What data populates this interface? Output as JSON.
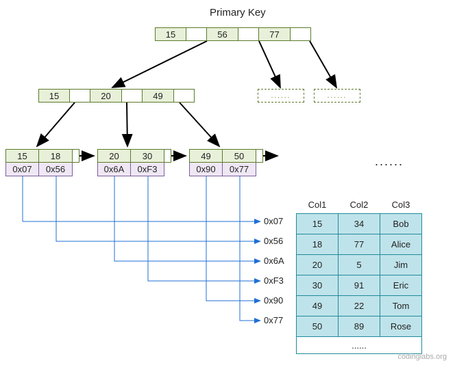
{
  "title": "Primary Key",
  "root": {
    "k": [
      "15",
      "56",
      "77"
    ]
  },
  "level2_left": {
    "k": [
      "15",
      "20",
      "49"
    ]
  },
  "level2_dash": "......",
  "leaf": [
    {
      "keys": [
        "15",
        "18"
      ],
      "addrs": [
        "0x07",
        "0x56"
      ]
    },
    {
      "keys": [
        "20",
        "30"
      ],
      "addrs": [
        "0x6A",
        "0xF3"
      ]
    },
    {
      "keys": [
        "49",
        "50"
      ],
      "addrs": [
        "0x90",
        "0x77"
      ]
    }
  ],
  "ellipsis": "......",
  "table": {
    "headers": [
      "Col1",
      "Col2",
      "Col3"
    ],
    "rows": [
      {
        "addr": "0x07",
        "c1": "15",
        "c2": "34",
        "c3": "Bob"
      },
      {
        "addr": "0x56",
        "c1": "18",
        "c2": "77",
        "c3": "Alice"
      },
      {
        "addr": "0x6A",
        "c1": "20",
        "c2": "5",
        "c3": "Jim"
      },
      {
        "addr": "0xF3",
        "c1": "30",
        "c2": "91",
        "c3": "Eric"
      },
      {
        "addr": "0x90",
        "c1": "49",
        "c2": "22",
        "c3": "Tom"
      },
      {
        "addr": "0x77",
        "c1": "50",
        "c2": "89",
        "c3": "Rose"
      }
    ],
    "rest": "......"
  },
  "source": "codinglabs.org"
}
